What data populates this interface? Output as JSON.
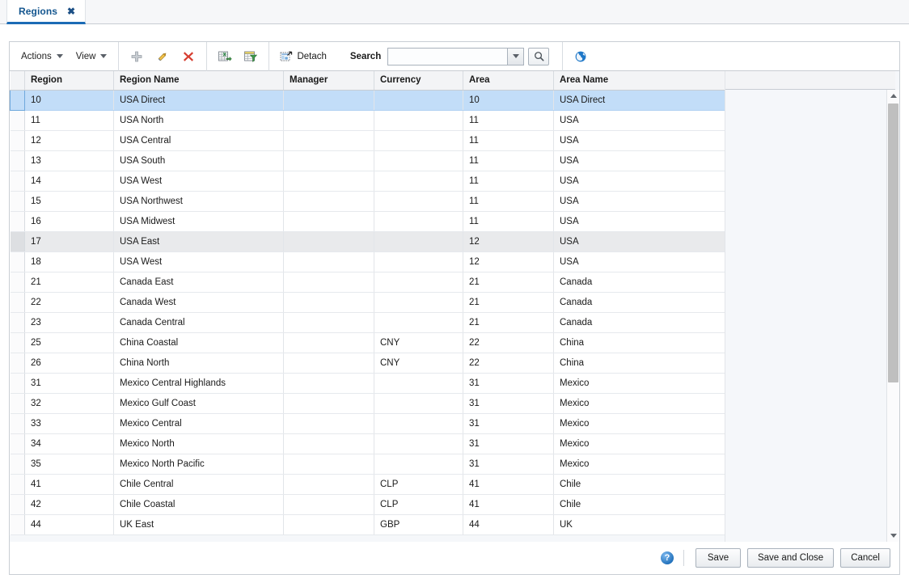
{
  "tab": {
    "label": "Regions",
    "close": "✖"
  },
  "toolbar": {
    "actions_label": "Actions",
    "view_label": "View",
    "add_title": "Add",
    "edit_title": "Edit",
    "delete_title": "Delete",
    "export_title": "Export to Excel",
    "filter_title": "Query by Example",
    "detach_label": "Detach",
    "search_label": "Search",
    "search_value": "",
    "search_placeholder": "",
    "translate_title": "Translate"
  },
  "table": {
    "columns": [
      "Region",
      "Region Name",
      "Manager",
      "Currency",
      "Area",
      "Area Name"
    ],
    "rows": [
      {
        "region": "10",
        "region_name": "USA Direct",
        "manager": "",
        "currency": "",
        "area": "10",
        "area_name": "USA Direct",
        "state": "selected"
      },
      {
        "region": "11",
        "region_name": "USA North",
        "manager": "",
        "currency": "",
        "area": "11",
        "area_name": "USA",
        "state": "normal"
      },
      {
        "region": "12",
        "region_name": "USA Central",
        "manager": "",
        "currency": "",
        "area": "11",
        "area_name": "USA",
        "state": "normal"
      },
      {
        "region": "13",
        "region_name": "USA South",
        "manager": "",
        "currency": "",
        "area": "11",
        "area_name": "USA",
        "state": "normal"
      },
      {
        "region": "14",
        "region_name": "USA West",
        "manager": "",
        "currency": "",
        "area": "11",
        "area_name": "USA",
        "state": "normal"
      },
      {
        "region": "15",
        "region_name": "USA Northwest",
        "manager": "",
        "currency": "",
        "area": "11",
        "area_name": "USA",
        "state": "normal"
      },
      {
        "region": "16",
        "region_name": "USA Midwest",
        "manager": "",
        "currency": "",
        "area": "11",
        "area_name": "USA",
        "state": "normal"
      },
      {
        "region": "17",
        "region_name": "USA East",
        "manager": "",
        "currency": "",
        "area": "12",
        "area_name": "USA",
        "state": "hover"
      },
      {
        "region": "18",
        "region_name": "USA West",
        "manager": "",
        "currency": "",
        "area": "12",
        "area_name": "USA",
        "state": "normal"
      },
      {
        "region": "21",
        "region_name": "Canada East",
        "manager": "",
        "currency": "",
        "area": "21",
        "area_name": "Canada",
        "state": "normal"
      },
      {
        "region": "22",
        "region_name": "Canada West",
        "manager": "",
        "currency": "",
        "area": "21",
        "area_name": "Canada",
        "state": "normal"
      },
      {
        "region": "23",
        "region_name": "Canada Central",
        "manager": "",
        "currency": "",
        "area": "21",
        "area_name": "Canada",
        "state": "normal"
      },
      {
        "region": "25",
        "region_name": "China Coastal",
        "manager": "",
        "currency": "CNY",
        "area": "22",
        "area_name": "China",
        "state": "normal"
      },
      {
        "region": "26",
        "region_name": "China North",
        "manager": "",
        "currency": "CNY",
        "area": "22",
        "area_name": "China",
        "state": "normal"
      },
      {
        "region": "31",
        "region_name": "Mexico Central Highlands",
        "manager": "",
        "currency": "",
        "area": "31",
        "area_name": "Mexico",
        "state": "normal"
      },
      {
        "region": "32",
        "region_name": "Mexico Gulf Coast",
        "manager": "",
        "currency": "",
        "area": "31",
        "area_name": "Mexico",
        "state": "normal"
      },
      {
        "region": "33",
        "region_name": "Mexico Central",
        "manager": "",
        "currency": "",
        "area": "31",
        "area_name": "Mexico",
        "state": "normal"
      },
      {
        "region": "34",
        "region_name": "Mexico North",
        "manager": "",
        "currency": "",
        "area": "31",
        "area_name": "Mexico",
        "state": "normal"
      },
      {
        "region": "35",
        "region_name": "Mexico North Pacific",
        "manager": "",
        "currency": "",
        "area": "31",
        "area_name": "Mexico",
        "state": "normal"
      },
      {
        "region": "41",
        "region_name": "Chile Central",
        "manager": "",
        "currency": "CLP",
        "area": "41",
        "area_name": "Chile",
        "state": "normal"
      },
      {
        "region": "42",
        "region_name": "Chile Coastal",
        "manager": "",
        "currency": "CLP",
        "area": "41",
        "area_name": "Chile",
        "state": "normal"
      },
      {
        "region": "44",
        "region_name": "UK East",
        "manager": "",
        "currency": "GBP",
        "area": "44",
        "area_name": "UK",
        "state": "normal"
      }
    ]
  },
  "footer": {
    "help_label": "?",
    "save_label": "Save",
    "save_close_label": "Save and Close",
    "cancel_label": "Cancel"
  },
  "colors": {
    "tab_accent": "#1b6bb5",
    "tab_text": "#14568f",
    "row_selected": "#c2ddf8",
    "row_hover": "#e9eaec",
    "header_bg": "#f3f4f6",
    "panel_border": "#c9ced4"
  }
}
